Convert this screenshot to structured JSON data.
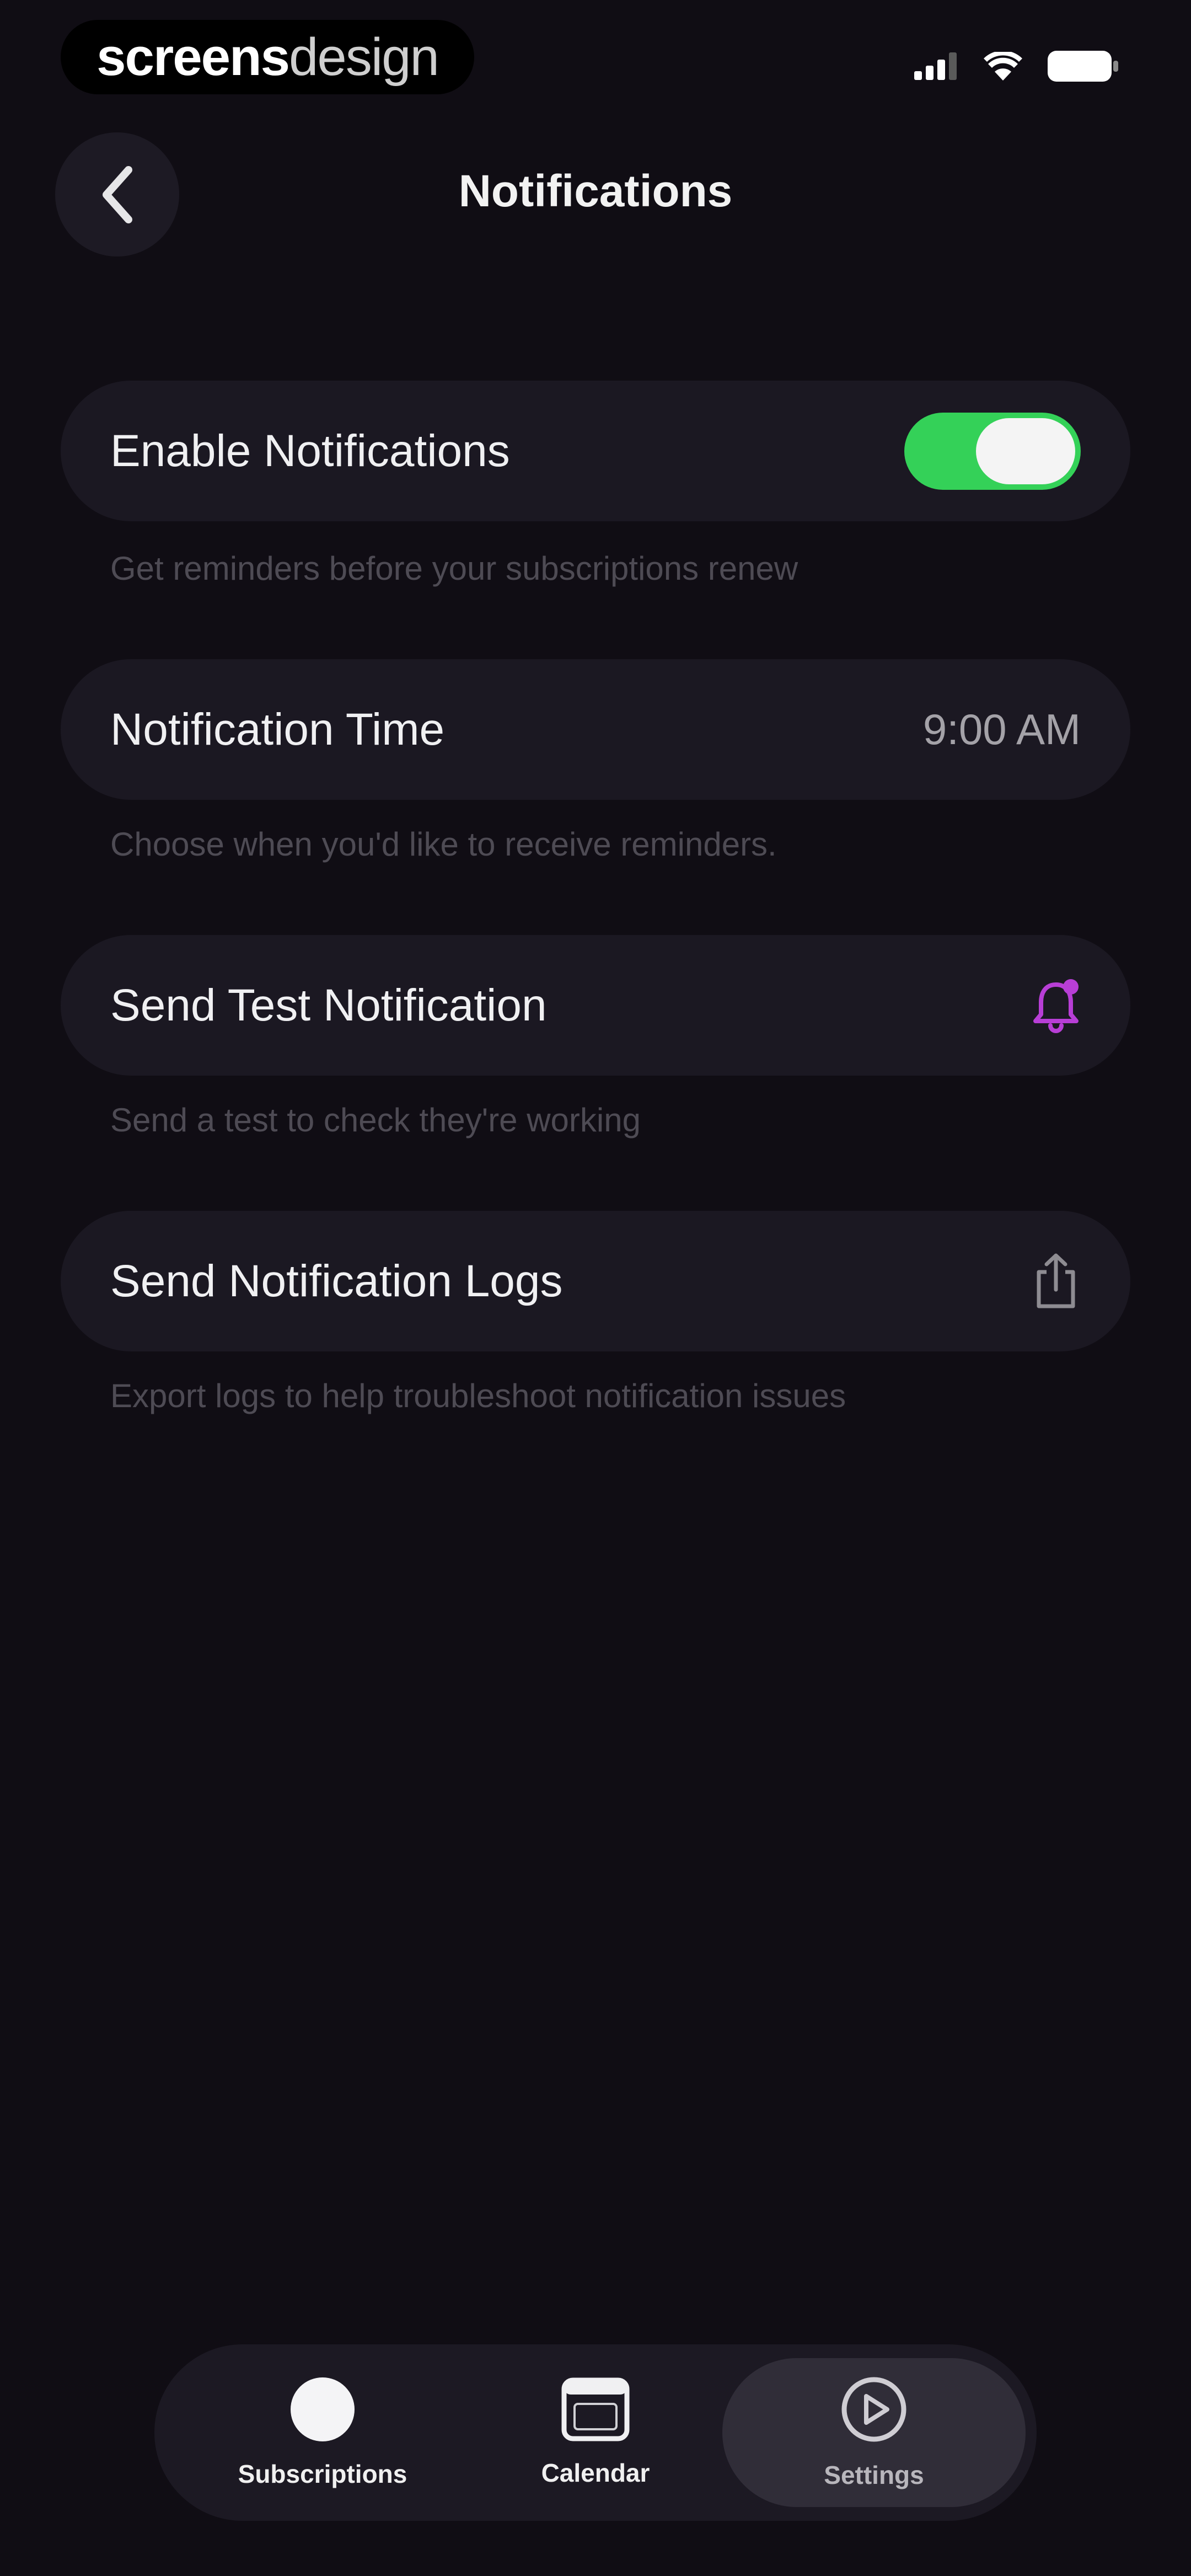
{
  "status_bar": {
    "brand_bold": "screens",
    "brand_light": "design"
  },
  "header": {
    "title": "Notifications"
  },
  "settings": [
    {
      "label": "Enable Notifications",
      "control": "toggle",
      "on": true,
      "description": "Get reminders before your subscriptions renew"
    },
    {
      "label": "Notification Time",
      "value": "9:00 AM",
      "description": "Choose when you'd like to receive reminders."
    },
    {
      "label": "Send Test Notification",
      "icon": "bell-badge-icon",
      "description": "Send a test to check they're working"
    },
    {
      "label": "Send Notification Logs",
      "icon": "share-icon",
      "description": "Export logs to help troubleshoot notification issues"
    }
  ],
  "tabbar": {
    "tabs": [
      {
        "label": "Subscriptions",
        "icon": "circle-icon"
      },
      {
        "label": "Calendar",
        "icon": "calendar-icon"
      },
      {
        "label": "Settings",
        "icon": "settings-icon",
        "active": true
      }
    ]
  },
  "colors": {
    "background": "#100d14",
    "card": "#1b1822",
    "toggle_on": "#34d158",
    "accent": "#b83ed6"
  }
}
